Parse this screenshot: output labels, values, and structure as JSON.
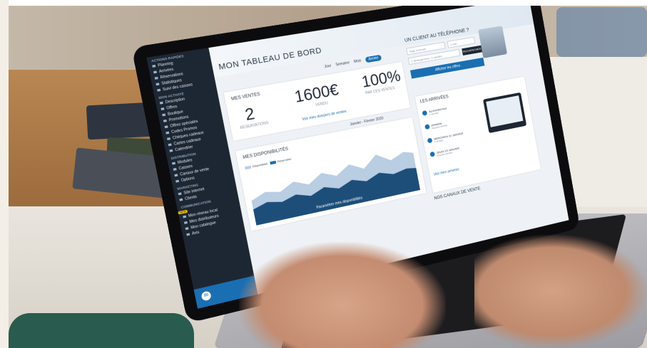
{
  "dashboard": {
    "title": "MON TABLEAU DE BORD",
    "periods": [
      "Jour",
      "Semaine",
      "Mois",
      "Année"
    ],
    "ventes": {
      "title": "MES VENTES",
      "reservations_value": "2",
      "reservations_label": "RÉSERVATIONS",
      "amount_value": "1600€",
      "amount_label": "VENDU",
      "percent_value": "100%",
      "percent_label": "PAR CES VENTES",
      "link": "Voir mes dossiers de ventes"
    },
    "date_range": "Janvier - Février 2020",
    "disponibilites": {
      "title": "MES DISPONIBILITÉS",
      "legend": [
        "Disponibles",
        "Réservées"
      ],
      "cta": "Paramétrer mes disponibilités"
    }
  },
  "sidebar": {
    "sections": [
      {
        "title": "ACTIONS RAPIDES",
        "items": [
          "Planning",
          "Arrivées",
          "Réservations",
          "Statistiques",
          "Suivi des caisses"
        ]
      },
      {
        "title": "MON ACTIVITÉ",
        "items": [
          "Description",
          "Offres",
          "Boutique",
          "Promotions",
          "Offres spéciales",
          "Codes Promos",
          "Chèques cadeaux",
          "Cartes cadeaux",
          "Calendrier"
        ]
      },
      {
        "title": "DISTRIBUTION",
        "items": [
          "Modules",
          "Caisses",
          "Canaux de vente",
          "Options"
        ]
      },
      {
        "title": "MARKETING",
        "items": [
          "Site internet",
          "Clients"
        ]
      },
      {
        "title": "COMMUNICATION",
        "badge": "NEW",
        "items": [
          "Mon réseau local",
          "Mes distributeurs",
          "Mon catalogue",
          "Avis"
        ]
      }
    ]
  },
  "phone": {
    "title": "UN CLIENT AU TÉLÉPHONE ?",
    "date_placeholder": "Date d'arrivée",
    "nights": "1 nuit",
    "guests": "1 hébergement / 2 adultes",
    "search_btn": "RECHERCHER",
    "offers_btn": "Afficher les offres"
  },
  "arrivals": {
    "title": "LES ARRIVÉES",
    "items": [
      {
        "day": "AUJOURD'HUI",
        "detail": "1 arrivée"
      },
      {
        "day": "DEMAIN",
        "detail": "Aucune arrivée"
      },
      {
        "day": "MERCREDI 22 JANVIER",
        "detail": "1 arrivée"
      },
      {
        "day": "JEUDI 23 JANVIER",
        "detail": "Aucune arrivée"
      }
    ],
    "link": "Voir mes arrivées"
  },
  "canaux_title": "NOS CANAUX DE VENTE",
  "colors": {
    "accent": "#1a6fb2",
    "sidebar": "#1d2733",
    "chart_dark": "#1d4e7a",
    "chart_light": "#b9cde3"
  }
}
